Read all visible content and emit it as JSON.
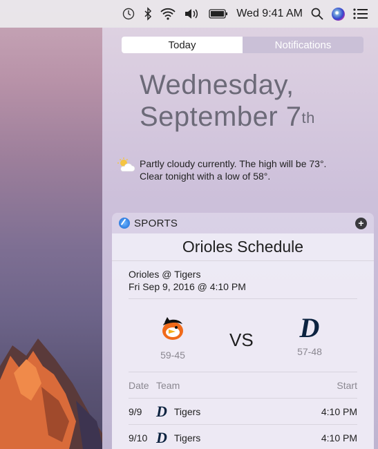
{
  "menubar": {
    "icons": [
      "time-machine-icon",
      "bluetooth-icon",
      "wifi-icon",
      "volume-icon",
      "battery-icon",
      "spotlight-icon",
      "siri-icon",
      "notification-center-icon"
    ],
    "clock": "Wed 9:41 AM"
  },
  "panel": {
    "tabs": [
      {
        "label": "Today",
        "active": true
      },
      {
        "label": "Notifications",
        "active": false
      }
    ],
    "date_line1": "Wednesday,",
    "date_line2": "September 7",
    "date_suffix": "th",
    "weather_line1": "Partly cloudy currently. The high will be 73°.",
    "weather_line2": "Clear tonight with a low of 58°."
  },
  "widget": {
    "app_name": "SPORTS",
    "add_symbol": "+",
    "schedule_title": "Orioles Schedule",
    "game_matchup": "Orioles @ Tigers",
    "game_time": "Fri Sep 9, 2016 @ 4:10 PM",
    "home_record": "59-45",
    "away_record": "57-48",
    "vs": "VS",
    "away_logo": "D",
    "table": {
      "headers": {
        "date": "Date",
        "team": "Team",
        "start": "Start"
      },
      "rows": [
        {
          "date": "9/9",
          "logo": "D",
          "team": "Tigers",
          "start": "4:10 PM"
        },
        {
          "date": "9/10",
          "logo": "D",
          "team": "Tigers",
          "start": "4:10 PM"
        }
      ]
    }
  },
  "colors": {
    "panel_bg": "#d6cce0",
    "date_text": "#6c6a78",
    "detroit_navy": "#0c2340",
    "orioles_orange": "#f06a1a"
  }
}
